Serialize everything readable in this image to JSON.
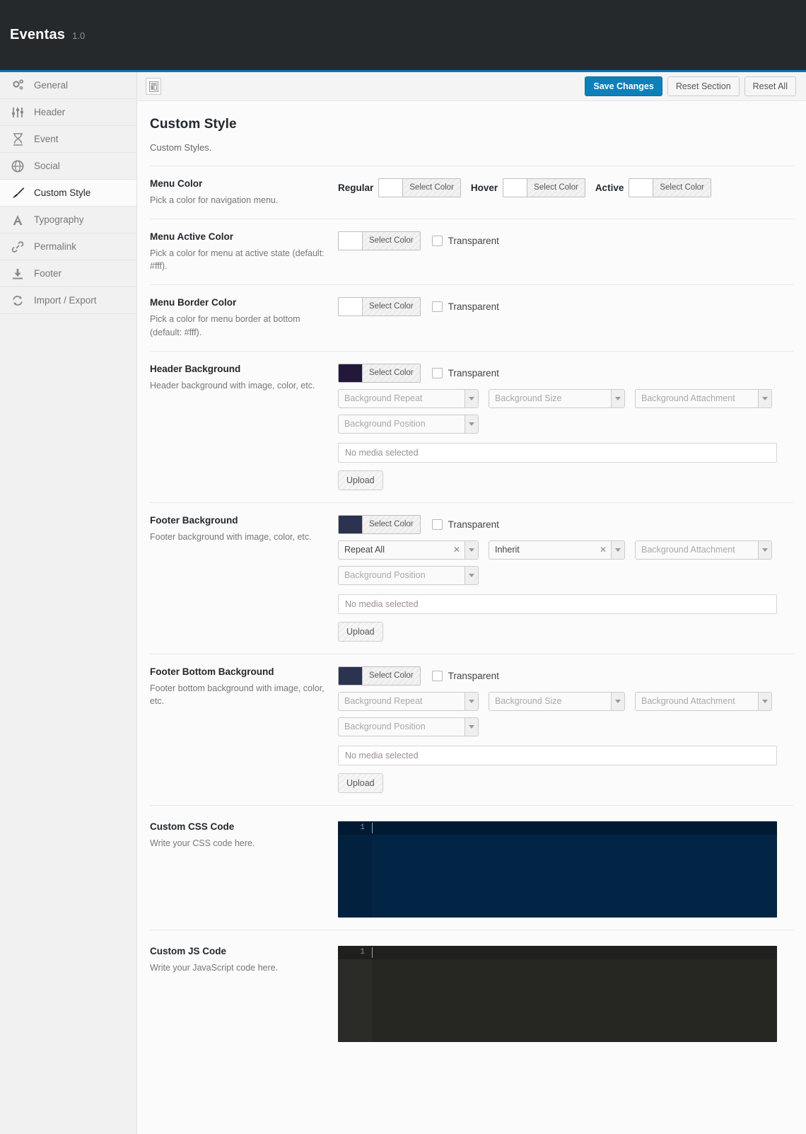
{
  "topbar": {
    "brand": "Eventas",
    "version": "1.0"
  },
  "sidebar": {
    "items": [
      {
        "label": "General",
        "icon": "gears-icon"
      },
      {
        "label": "Header",
        "icon": "sliders-icon"
      },
      {
        "label": "Event",
        "icon": "hourglass-icon"
      },
      {
        "label": "Social",
        "icon": "globe-icon"
      },
      {
        "label": "Custom Style",
        "icon": "paintbrush-icon",
        "active": true
      },
      {
        "label": "Typography",
        "icon": "letter-a-icon"
      },
      {
        "label": "Permalink",
        "icon": "link-icon"
      },
      {
        "label": "Footer",
        "icon": "download-icon"
      },
      {
        "label": "Import / Export",
        "icon": "refresh-icon"
      }
    ]
  },
  "toolbar": {
    "panel_toggle_icon": "layout-panel-icon",
    "save_label": "Save Changes",
    "reset_section_label": "Reset Section",
    "reset_all_label": "Reset All",
    "accent_color": "#0d80b9"
  },
  "section": {
    "title": "Custom Style",
    "description": "Custom Styles."
  },
  "common": {
    "select_color": "Select Color",
    "transparent": "Transparent",
    "no_media": "No media selected",
    "upload": "Upload",
    "bg_repeat_placeholder": "Background Repeat",
    "bg_size_placeholder": "Background Size",
    "bg_attachment_placeholder": "Background Attachment",
    "bg_position_placeholder": "Background Position",
    "clear_glyph": "✕",
    "line_number": "1"
  },
  "fields": {
    "menu_color": {
      "title": "Menu Color",
      "sub": "Pick a color for navigation menu.",
      "states": [
        {
          "label": "Regular",
          "swatch": "#ffffff"
        },
        {
          "label": "Hover",
          "swatch": "#ffffff"
        },
        {
          "label": "Active",
          "swatch": "#ffffff"
        }
      ]
    },
    "menu_active_color": {
      "title": "Menu Active Color",
      "sub": "Pick a color for menu at active state (default: #fff).",
      "swatch": "#ffffff",
      "transparent_checked": false
    },
    "menu_border_color": {
      "title": "Menu Border Color",
      "sub": "Pick a color for menu border at bottom (default: #fff).",
      "swatch": "#ffffff",
      "transparent_checked": false
    },
    "header_background": {
      "title": "Header Background",
      "sub": "Header background with image, color, etc.",
      "swatch": "#231839",
      "transparent_checked": false,
      "repeat_value": "",
      "size_value": "",
      "attachment_value": "",
      "position_value": ""
    },
    "footer_background": {
      "title": "Footer Background",
      "sub": "Footer background with image, color, etc.",
      "swatch": "#2b3350",
      "transparent_checked": false,
      "repeat_value": "Repeat All",
      "size_value": "Inherit",
      "attachment_value": "",
      "position_value": ""
    },
    "footer_bottom_background": {
      "title": "Footer Bottom Background",
      "sub": "Footer bottom background with image, color, etc.",
      "swatch": "#2b3350",
      "transparent_checked": false,
      "repeat_value": "",
      "size_value": "",
      "attachment_value": "",
      "position_value": ""
    },
    "custom_css": {
      "title": "Custom CSS Code",
      "sub": "Write your CSS code here.",
      "code": "",
      "theme_bg": "#022546"
    },
    "custom_js": {
      "title": "Custom JS Code",
      "sub": "Write your JavaScript code here.",
      "code": "",
      "theme_bg": "#262723"
    }
  }
}
